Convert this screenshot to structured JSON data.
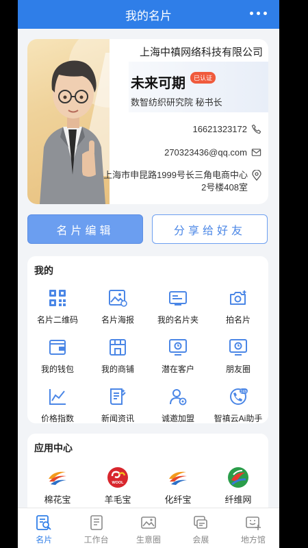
{
  "header": {
    "title": "我的名片"
  },
  "card": {
    "company": "上海中禛网络科技有限公司",
    "name": "未来可期",
    "verified_badge": "已认证",
    "position": "数智纺织研究院 秘书长",
    "phone": "16621323172",
    "email": "270323436@qq.com",
    "address_line1": "上海市申昆路1999号长三角电商中心",
    "address_line2": "2号楼408室"
  },
  "actions": {
    "edit": "名片编辑",
    "share": "分享给好友"
  },
  "me_section": {
    "title": "我的",
    "items": [
      {
        "label": "名片二维码",
        "icon": "qr-code-icon"
      },
      {
        "label": "名片海报",
        "icon": "poster-icon"
      },
      {
        "label": "我的名片夹",
        "icon": "card-holder-icon"
      },
      {
        "label": "拍名片",
        "icon": "camera-icon"
      },
      {
        "label": "我的钱包",
        "icon": "wallet-icon"
      },
      {
        "label": "我的商铺",
        "icon": "shop-icon"
      },
      {
        "label": "潜在客户",
        "icon": "potential-customer-icon"
      },
      {
        "label": "朋友圈",
        "icon": "moments-icon"
      },
      {
        "label": "价格指数",
        "icon": "price-index-icon"
      },
      {
        "label": "新闻资讯",
        "icon": "news-icon"
      },
      {
        "label": "诚邀加盟",
        "icon": "join-icon"
      },
      {
        "label": "智禛云Ai助手",
        "icon": "ai-assistant-icon"
      }
    ]
  },
  "app_section": {
    "title": "应用中心",
    "items": [
      {
        "label": "棉花宝",
        "icon": "cotton-logo-icon"
      },
      {
        "label": "羊毛宝",
        "icon": "wool-logo-icon",
        "logo_text": "WOOL"
      },
      {
        "label": "化纤宝",
        "icon": "chemical-fiber-logo-icon"
      },
      {
        "label": "纤维网",
        "icon": "fiber-net-logo-icon"
      }
    ]
  },
  "tabbar": {
    "items": [
      {
        "label": "名片",
        "active": true
      },
      {
        "label": "工作台",
        "active": false
      },
      {
        "label": "生意圈",
        "active": false
      },
      {
        "label": "会展",
        "active": false
      },
      {
        "label": "地方馆",
        "active": false
      }
    ]
  },
  "colors": {
    "primary": "#2f7ee8",
    "accent": "#6b9ef0",
    "badge": "#f05a3c"
  }
}
